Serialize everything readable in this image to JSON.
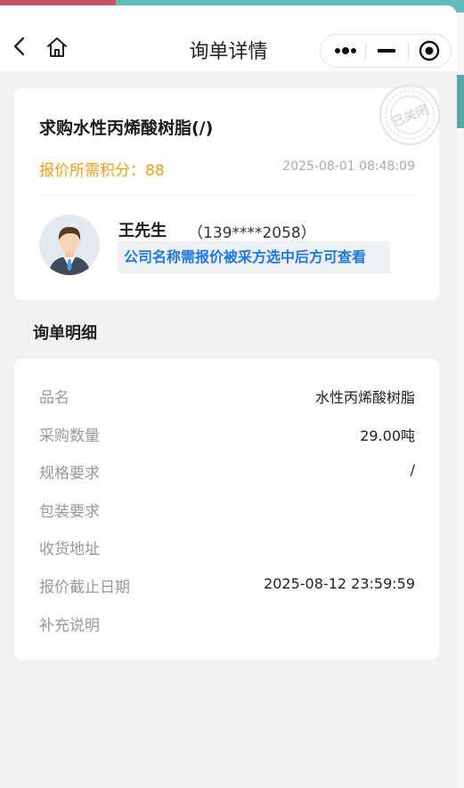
{
  "navbar": {
    "title": "询单详情",
    "icons": {
      "back": "back-arrow-icon",
      "home": "home-icon",
      "more": "more-dots-icon",
      "minimize": "minimize-icon",
      "close": "target-circle-icon"
    }
  },
  "header": {
    "title": "求购水性丙烯酸树脂(/)",
    "points_label": "报价所需积分：88",
    "date": "2025-08-01 08:48:09",
    "seal_text": "已关闭",
    "contact": {
      "name": "王先生",
      "phone": "（139****2058）",
      "notice": "公司名称需报价被采方选中后方可查看"
    }
  },
  "details": {
    "section_title": "询单明细",
    "rows": [
      {
        "label": "品名",
        "value": "水性丙烯酸树脂"
      },
      {
        "label": "采购数量",
        "value": "29.00吨"
      },
      {
        "label": "规格要求",
        "value": "/"
      },
      {
        "label": "包装要求",
        "value": ""
      },
      {
        "label": "收货地址",
        "value": ""
      },
      {
        "label": "报价截止日期",
        "value": "2025-08-12 23:59:59"
      },
      {
        "label": "补充说明",
        "value": ""
      }
    ]
  },
  "colors": {
    "accent_orange": "#f59c16",
    "link_blue": "#1e79e6",
    "muted": "#999999"
  }
}
